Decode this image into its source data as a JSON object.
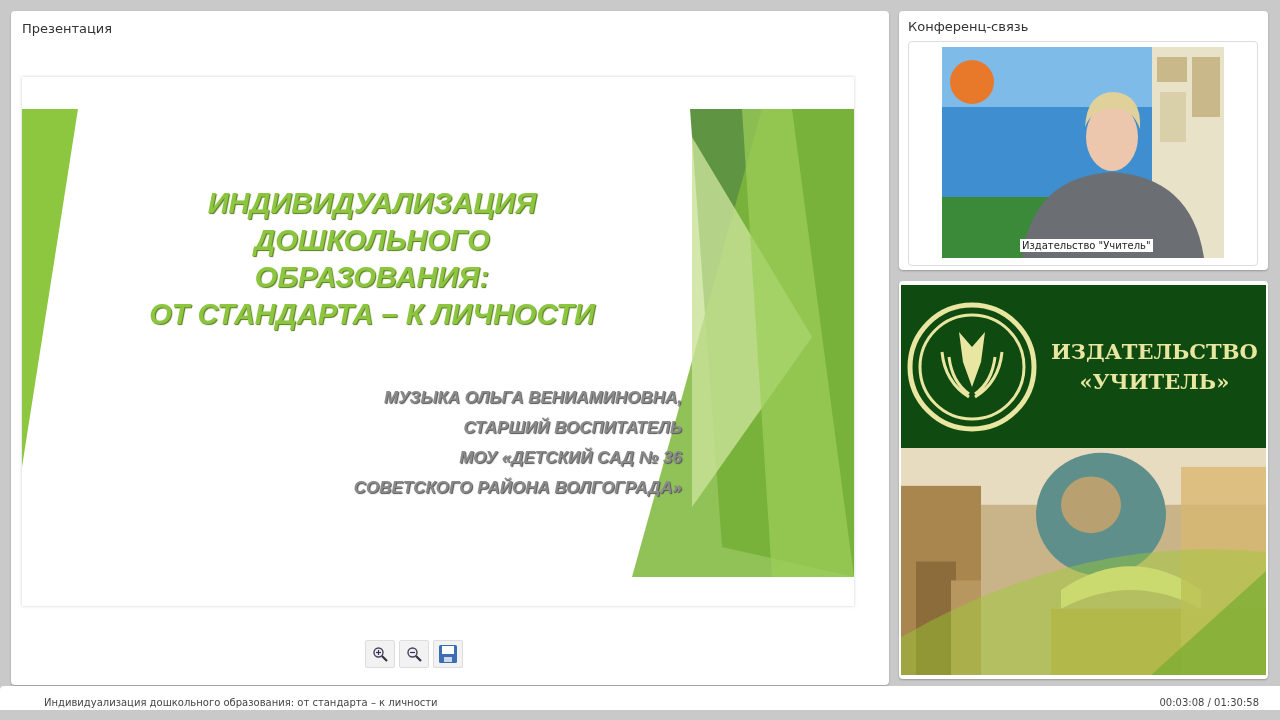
{
  "presentation": {
    "title": "Презентация",
    "slide": {
      "heading": [
        "ИНДИВИДУАЛИЗАЦИЯ",
        "ДОШКОЛЬНОГО",
        "ОБРАЗОВАНИЯ:",
        "ОТ СТАНДАРТА – К ЛИЧНОСТИ"
      ],
      "author": [
        "МУЗЫКА ОЛЬГА ВЕНИАМИНОВНА,",
        "СТАРШИЙ ВОСПИТАТЕЛЬ",
        "МОУ «ДЕТСКИЙ САД № 36",
        "СОВЕТСКОГО РАЙОНА ВОЛГОГРАДА»"
      ]
    },
    "tools": [
      {
        "kind": "zoom-in"
      },
      {
        "kind": "zoom-out"
      },
      {
        "kind": "save"
      }
    ]
  },
  "conference": {
    "title": "Конференц-связь",
    "video": {
      "kind": "picture",
      "caption": "Издательство \"Учитель\""
    }
  },
  "banner": {
    "lines": [
      "ИЗДАТЕЛЬСТВО",
      "«УЧИТЕЛЬ»"
    ],
    "photo": {
      "kind": "picture"
    }
  },
  "status_bar": {
    "title": "Индивидуализация дошкольного образования: от стандарта – к личности",
    "time": "00:03:08 / 01:30:58"
  }
}
